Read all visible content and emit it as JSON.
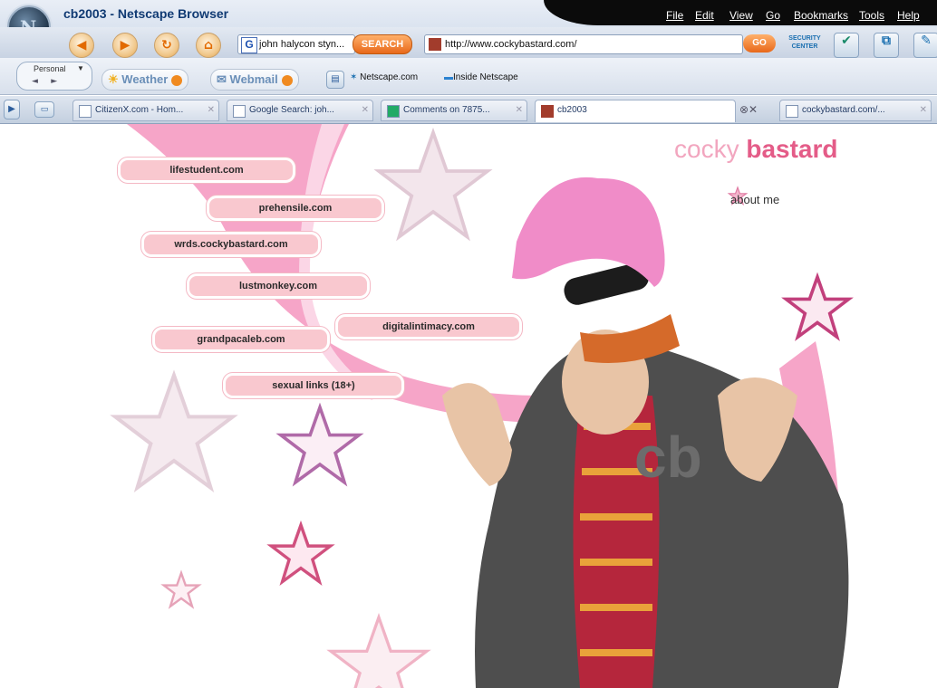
{
  "window": {
    "title": "cb2003 - Netscape Browser"
  },
  "menu": [
    "File",
    "Edit",
    "View",
    "Go",
    "Bookmarks",
    "Tools",
    "Help"
  ],
  "navigation": {
    "search_value": "john halycon styn...",
    "search_button": "SEARCH",
    "url": "http://www.cockybastard.com/",
    "go_button": "GO",
    "security_center": "SECURITY CENTER"
  },
  "personal_toolbar": {
    "personal_label": "Personal",
    "weather_label": "Weather",
    "webmail_label": "Webmail",
    "netscape_label": "Netscape.com",
    "inside_label": "Inside Netscape"
  },
  "tabs": [
    {
      "label": "CitizenX.com - Hom..."
    },
    {
      "label": "Google Search: joh..."
    },
    {
      "label": "Comments on 7875..."
    },
    {
      "label": "cb2003"
    },
    {
      "label": "cockybastard.com/..."
    }
  ],
  "site": {
    "title_light": "cocky ",
    "title_bold": "bastard",
    "about_label": "about me",
    "links": [
      "lifestudent.com",
      "prehensile.com",
      "wrds.cockybastard.com",
      "lustmonkey.com",
      "digitalintimacy.com",
      "grandpacaleb.com",
      "sexual links (18+)"
    ],
    "star_badge": "cb"
  },
  "colors": {
    "accent_pink": "#e45c88",
    "light_pink": "#f9c8cf",
    "swoosh_pink": "#f6a5c8"
  }
}
